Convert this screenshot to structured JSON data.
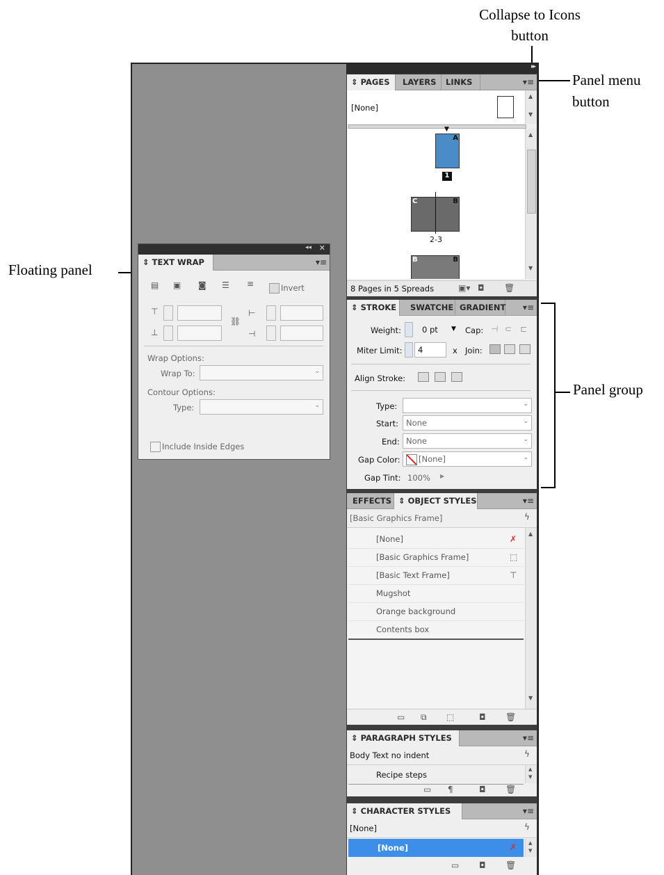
{
  "callouts": {
    "collapse_line1": "Collapse to Icons",
    "collapse_line2": "button",
    "panel_menu_line1": "Panel menu",
    "panel_menu_line2": "button",
    "floating_panel": "Floating panel",
    "panel_group": "Panel group"
  },
  "pages_panel": {
    "tabs": [
      "PAGES",
      "LAYERS",
      "LINKS"
    ],
    "master": "[None]",
    "page_labels": [
      "1",
      "2-3"
    ],
    "master_letters": [
      "A",
      "C",
      "B",
      "B",
      "B"
    ],
    "status": "8 Pages in 5 Spreads"
  },
  "stroke_panel": {
    "tabs": [
      "STROKE",
      "SWATCHE",
      "GRADIENT"
    ],
    "weight_label": "Weight:",
    "weight_value": "0 pt",
    "cap_label": "Cap:",
    "miter_label": "Miter Limit:",
    "miter_value": "4",
    "miter_unit": "x",
    "join_label": "Join:",
    "align_label": "Align Stroke:",
    "type_label": "Type:",
    "type_value": "",
    "start_label": "Start:",
    "start_value": "None",
    "end_label": "End:",
    "end_value": "None",
    "gap_color_label": "Gap Color:",
    "gap_color_value": "[None]",
    "gap_tint_label": "Gap Tint:",
    "gap_tint_value": "100%"
  },
  "object_styles_panel": {
    "tabs": [
      "EFFECTS",
      "OBJECT STYLES"
    ],
    "current": "[Basic Graphics Frame]",
    "items": [
      "[None]",
      "[Basic Graphics Frame]",
      "[Basic Text Frame]",
      "Mugshot",
      "Orange background",
      "Contents box"
    ]
  },
  "paragraph_styles_panel": {
    "tab": "PARAGRAPH STYLES",
    "current": "Body Text no indent",
    "items": [
      "Recipe steps"
    ]
  },
  "character_styles_panel": {
    "tab": "CHARACTER STYLES",
    "current": "[None]",
    "selected": "[None]"
  },
  "text_wrap_panel": {
    "tab": "TEXT WRAP",
    "invert_label": "Invert",
    "wrap_options_label": "Wrap Options:",
    "wrap_to_label": "Wrap To:",
    "contour_options_label": "Contour Options:",
    "type_label": "Type:",
    "include_inside_label": "Include Inside Edges"
  },
  "colors": {
    "selection": "#3d8ee8",
    "pasteboard": "#8f8f8f",
    "dock": "#3d3d3d"
  }
}
